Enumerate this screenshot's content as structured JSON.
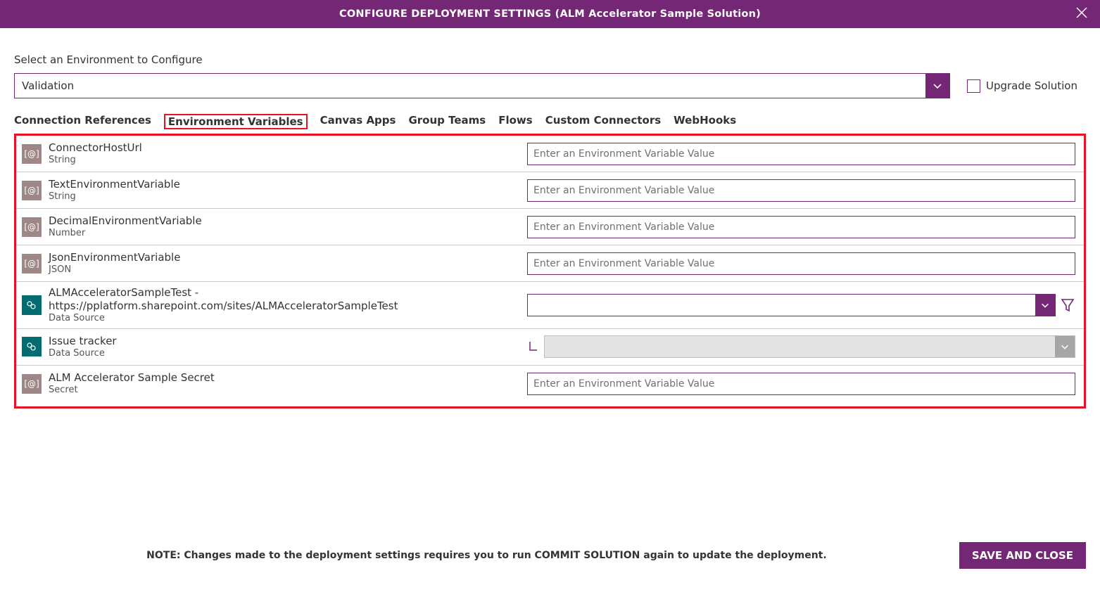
{
  "header": {
    "title": "CONFIGURE DEPLOYMENT SETTINGS (ALM Accelerator Sample Solution)"
  },
  "environment": {
    "label": "Select an Environment to Configure",
    "selected": "Validation",
    "upgrade_label": "Upgrade Solution"
  },
  "tabs": [
    "Connection References",
    "Environment Variables",
    "Canvas Apps",
    "Group Teams",
    "Flows",
    "Custom Connectors",
    "WebHooks"
  ],
  "active_tab_index": 1,
  "variables": [
    {
      "name": "ConnectorHostUrl",
      "type": "String",
      "kind": "text",
      "placeholder": "Enter an Environment Variable Value",
      "icon": "var"
    },
    {
      "name": "TextEnvironmentVariable",
      "type": "String",
      "kind": "text",
      "placeholder": "Enter an Environment Variable Value",
      "icon": "var"
    },
    {
      "name": "DecimalEnvironmentVariable",
      "type": "Number",
      "kind": "text",
      "placeholder": "Enter an Environment Variable Value",
      "icon": "var"
    },
    {
      "name": "JsonEnvironmentVariable",
      "type": "JSON",
      "kind": "text",
      "placeholder": "Enter an Environment Variable Value",
      "icon": "var"
    },
    {
      "name": "ALMAcceleratorSampleTest - https://pplatform.sharepoint.com/sites/ALMAcceleratorSampleTest",
      "type": "Data Source",
      "kind": "select",
      "icon": "sp"
    },
    {
      "name": "Issue tracker",
      "type": "Data Source",
      "kind": "select-disabled",
      "icon": "sp"
    },
    {
      "name": "ALM Accelerator Sample Secret",
      "type": "Secret",
      "kind": "text",
      "placeholder": "Enter an Environment Variable Value",
      "icon": "var"
    }
  ],
  "footer": {
    "note": "NOTE: Changes made to the deployment settings requires you to run COMMIT SOLUTION again to update the deployment.",
    "save_label": "SAVE AND CLOSE"
  }
}
